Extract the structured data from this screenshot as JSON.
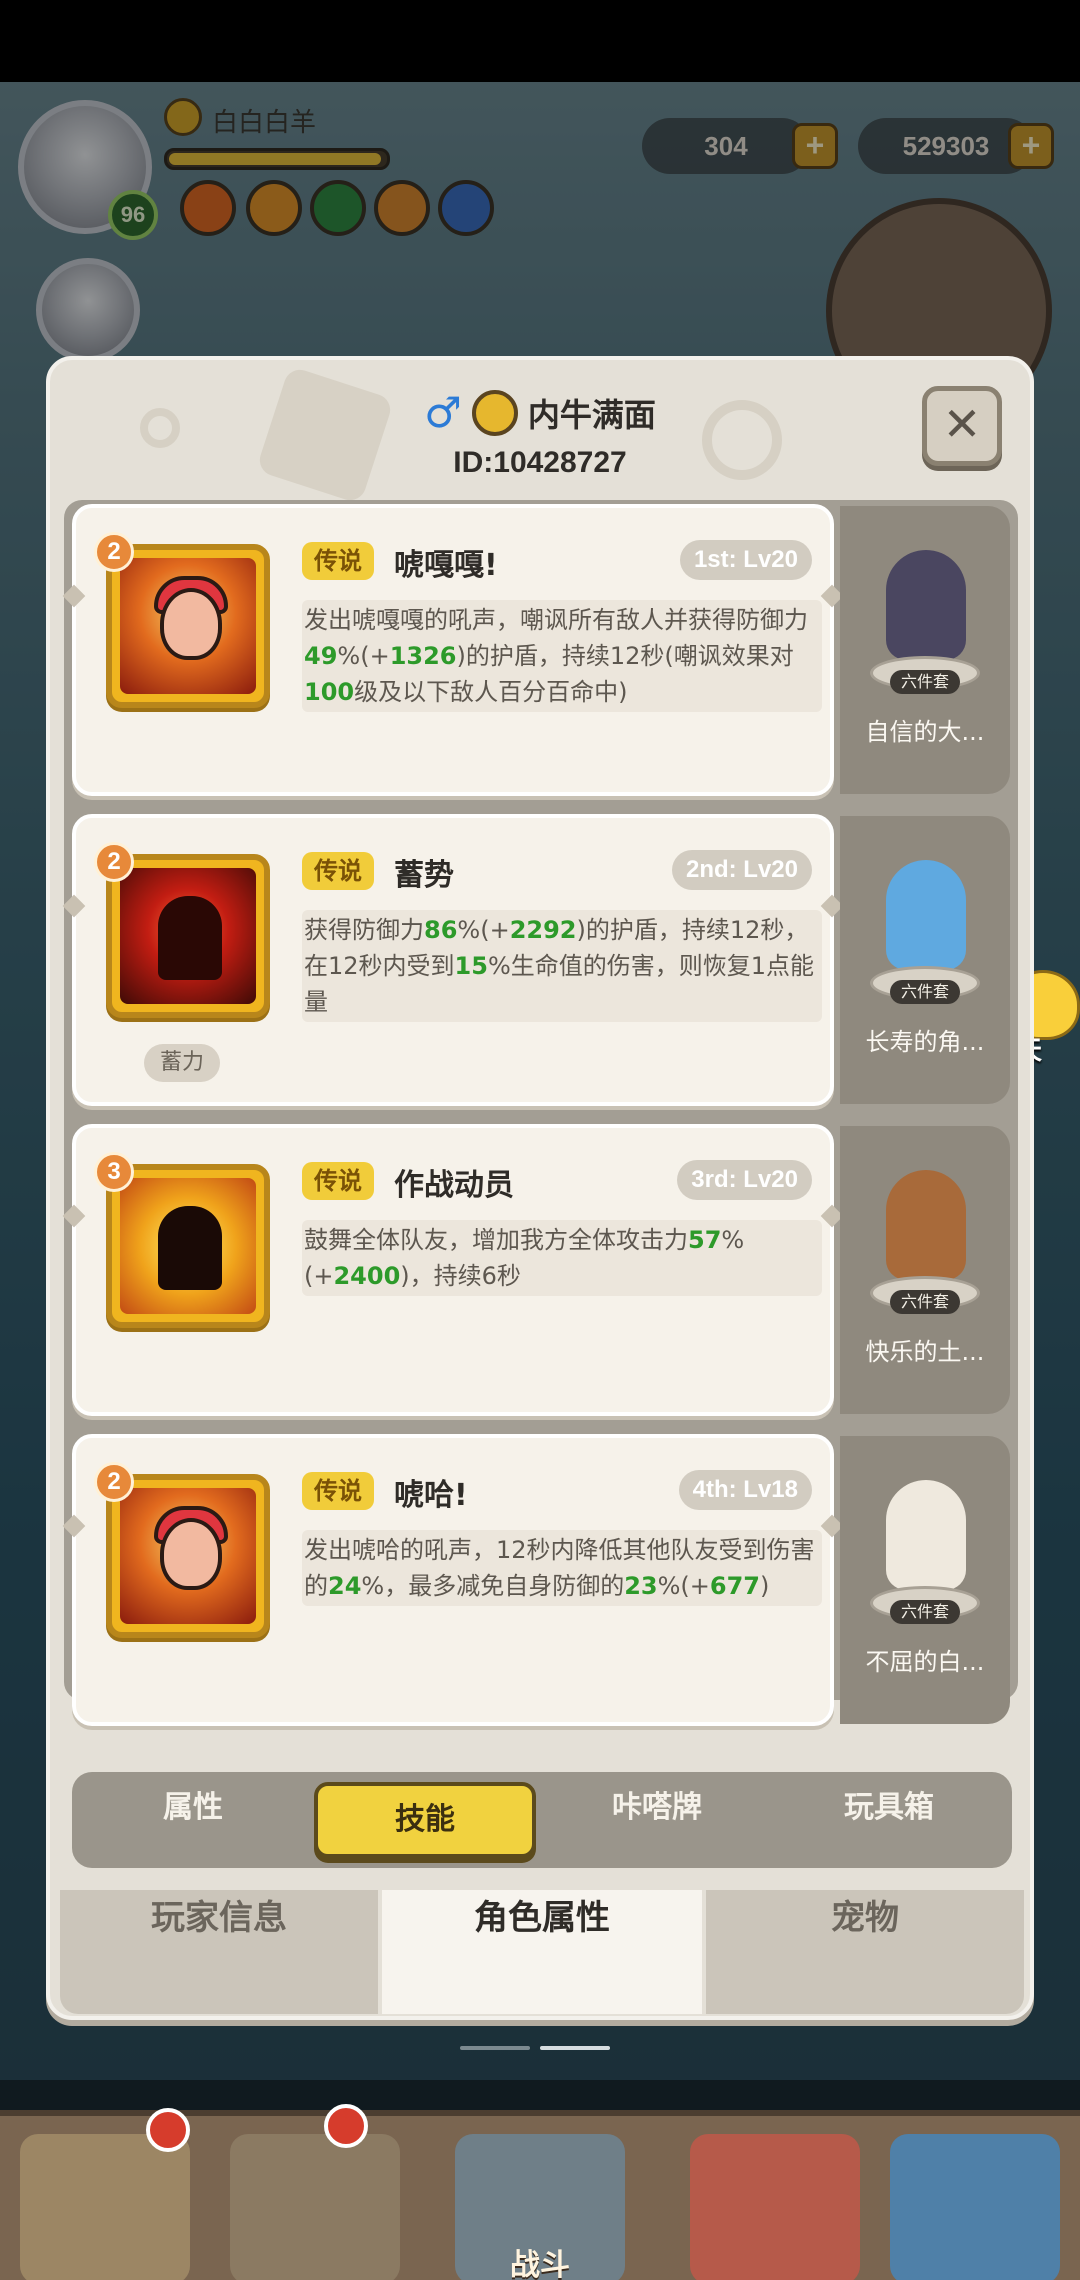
{
  "hud": {
    "player_name": "白白白羊",
    "player_level": "96",
    "currency_1": "304",
    "currency_2": "529303"
  },
  "dialog": {
    "gender_icon": "♂",
    "player_name": "内牛满面",
    "player_id": "ID:10428727",
    "close_glyph": "✕"
  },
  "skills": [
    {
      "rank": "2",
      "badge": "传说",
      "name": "唬嘎嘎!",
      "level": "1st: Lv20",
      "desc_parts": [
        "发出唬嘎嘎的吼声，嘲讽所有敌人并获得防御力",
        "49",
        "%(+",
        "1326",
        ")的护盾，持续12秒(嘲讽效果对",
        "100",
        "级及以下敌人百分百命中)"
      ],
      "tag": ""
    },
    {
      "rank": "2",
      "badge": "传说",
      "name": "蓄势",
      "level": "2nd: Lv20",
      "desc_parts": [
        "获得防御力",
        "86",
        "%(+",
        "2292",
        ")的护盾，持续12秒，在12秒内受到",
        "15",
        "%生命值的伤害，则恢复1点能量"
      ],
      "tag": "蓄力"
    },
    {
      "rank": "3",
      "badge": "传说",
      "name": "作战动员",
      "level": "3rd: Lv20",
      "desc_parts": [
        "鼓舞全体队友，增加我方全体攻击力",
        "57",
        "%(+",
        "2400",
        ")，持续6秒",
        "",
        ""
      ],
      "tag": ""
    },
    {
      "rank": "2",
      "badge": "传说",
      "name": "唬哈!",
      "level": "4th: Lv18",
      "desc_parts": [
        "发出唬哈的吼声，12秒内降低其他队友受到伤害的",
        "24",
        "%，最多减免自身防御的",
        "23",
        "%(+",
        "677",
        ")"
      ],
      "tag": ""
    }
  ],
  "pets": [
    {
      "badge": "六件套",
      "name": "自信的大...",
      "color": "#4a4660"
    },
    {
      "badge": "六件套",
      "name": "长寿的角...",
      "color": "#5fa9e0"
    },
    {
      "badge": "六件套",
      "name": "快乐的土...",
      "color": "#a86a3a"
    },
    {
      "badge": "六件套",
      "name": "不屈的白...",
      "color": "#efe9de"
    }
  ],
  "subtabs": [
    "属性",
    "技能",
    "咔嗒牌",
    "玩具箱"
  ],
  "subtab_active": 1,
  "bottomtabs": [
    "玩家信息",
    "角色属性",
    "宠物"
  ],
  "bottomtab_active": 1,
  "chat_label": "聊天",
  "nav_battle_label": "战斗",
  "colors": {
    "legend_badge": "#f1cc3a",
    "highlight_number": "#2d9a2a",
    "active_tab": "#f1d23f"
  }
}
